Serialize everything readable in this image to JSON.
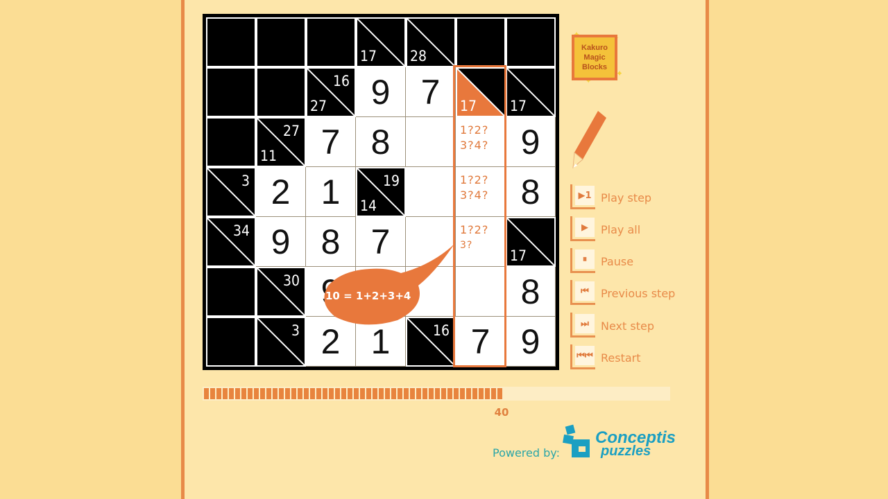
{
  "logo": {
    "lines": [
      "Kakuro",
      "Magic",
      "Blocks"
    ]
  },
  "controls": [
    {
      "id": "play-step",
      "label": "Play step",
      "icon": "▶1"
    },
    {
      "id": "play-all",
      "label": "Play all",
      "icon": "▶"
    },
    {
      "id": "pause",
      "label": "Pause",
      "icon": "⏸"
    },
    {
      "id": "previous-step",
      "label": "Previous step",
      "icon": "⏮"
    },
    {
      "id": "next-step",
      "label": "Next step",
      "icon": "⏭"
    },
    {
      "id": "restart",
      "label": "Restart",
      "icon": "⏮⏮"
    }
  ],
  "progress": {
    "value": 40,
    "fraction": 0.645
  },
  "bubble": {
    "text": "10 = 1+2+3+4"
  },
  "powered_by": "Powered by:",
  "conceptis": {
    "line1": "Conceptis",
    "line2": "puzzles"
  },
  "colors": {
    "accent": "#e8783c",
    "panel": "#fde6aa",
    "background": "#fbdd94",
    "teal": "#1b9fc2"
  },
  "puzzle": {
    "rows": [
      [
        {
          "t": "b"
        },
        {
          "t": "b"
        },
        {
          "t": "b"
        },
        {
          "t": "c",
          "d": "17"
        },
        {
          "t": "c",
          "d": "28"
        },
        {
          "t": "b"
        },
        {
          "t": "b"
        }
      ],
      [
        {
          "t": "b"
        },
        {
          "t": "b"
        },
        {
          "t": "c",
          "r": "16",
          "d": "27"
        },
        {
          "t": "w",
          "v": "9"
        },
        {
          "t": "w",
          "v": "7"
        },
        {
          "t": "c",
          "d": "17",
          "hl": true
        },
        {
          "t": "c",
          "d": "17"
        }
      ],
      [
        {
          "t": "b"
        },
        {
          "t": "c",
          "r": "27",
          "d": "11"
        },
        {
          "t": "w",
          "v": "7"
        },
        {
          "t": "w",
          "v": "8"
        },
        {
          "t": "w",
          "v": ""
        },
        {
          "t": "w",
          "cands": [
            "1?2?",
            "3?4?"
          ]
        },
        {
          "t": "w",
          "v": "9"
        }
      ],
      [
        {
          "t": "c",
          "r": "3"
        },
        {
          "t": "w",
          "v": "2"
        },
        {
          "t": "w",
          "v": "1"
        },
        {
          "t": "c",
          "r": "19",
          "d": "14"
        },
        {
          "t": "w",
          "v": ""
        },
        {
          "t": "w",
          "cands": [
            "1?2?",
            "3?4?"
          ]
        },
        {
          "t": "w",
          "v": "8"
        }
      ],
      [
        {
          "t": "c",
          "r": "34"
        },
        {
          "t": "w",
          "v": "9"
        },
        {
          "t": "w",
          "v": "8"
        },
        {
          "t": "w",
          "v": "7"
        },
        {
          "t": "w",
          "v": ""
        },
        {
          "t": "w",
          "cands": [
            "1?2?",
            "3?"
          ]
        },
        {
          "t": "c",
          "d": "17"
        }
      ],
      [
        {
          "t": "b"
        },
        {
          "t": "c",
          "r": "30"
        },
        {
          "t": "w",
          "v": "9"
        },
        {
          "t": "w",
          "v": ""
        },
        {
          "t": "w",
          "v": ""
        },
        {
          "t": "w",
          "v": ""
        },
        {
          "t": "w",
          "v": "8"
        }
      ],
      [
        {
          "t": "b"
        },
        {
          "t": "c",
          "r": "3"
        },
        {
          "t": "w",
          "v": "2"
        },
        {
          "t": "w",
          "v": "1"
        },
        {
          "t": "c",
          "r": "16"
        },
        {
          "t": "w",
          "v": "7"
        },
        {
          "t": "w",
          "v": "9"
        }
      ]
    ]
  }
}
